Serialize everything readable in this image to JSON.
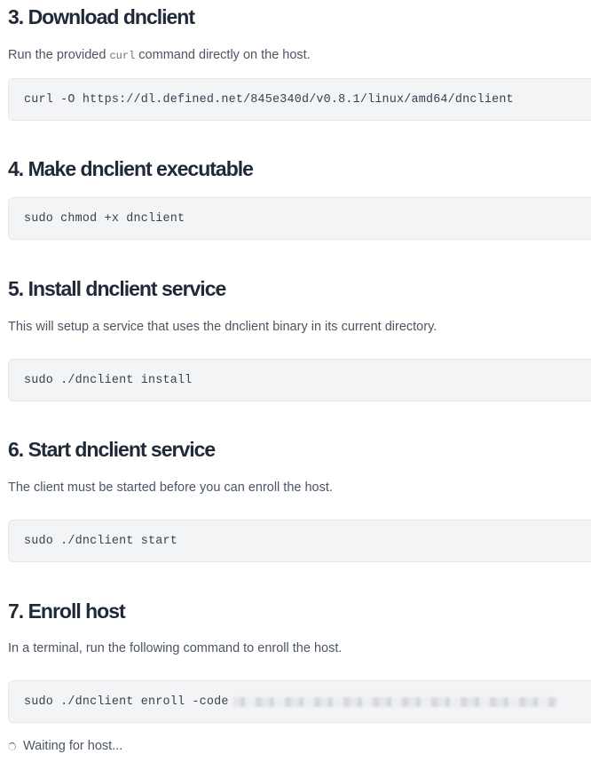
{
  "steps": [
    {
      "title": "3. Download dnclient",
      "description_before": "Run the provided ",
      "description_code": "curl",
      "description_after": " command directly on the host.",
      "command": "curl -O https://dl.defined.net/845e340d/v0.8.1/linux/amd64/dnclient"
    },
    {
      "title": "4. Make dnclient executable",
      "command": "sudo chmod +x dnclient"
    },
    {
      "title": "5. Install dnclient service",
      "description": "This will setup a service that uses the dnclient binary in its current directory.",
      "command": "sudo ./dnclient install"
    },
    {
      "title": "6. Start dnclient service",
      "description": "The client must be started before you can enroll the host.",
      "command": "sudo ./dnclient start"
    },
    {
      "title": "7. Enroll host",
      "description": "In a terminal, run the following command to enroll the host.",
      "command": "sudo ./dnclient enroll -code"
    }
  ],
  "status": {
    "icon": "spinner-icon",
    "text": "Waiting for host..."
  },
  "colors": {
    "heading": "#1f2937",
    "body_text": "#4b5563",
    "code_background": "#f3f4f6",
    "code_border": "#e5e7eb"
  }
}
